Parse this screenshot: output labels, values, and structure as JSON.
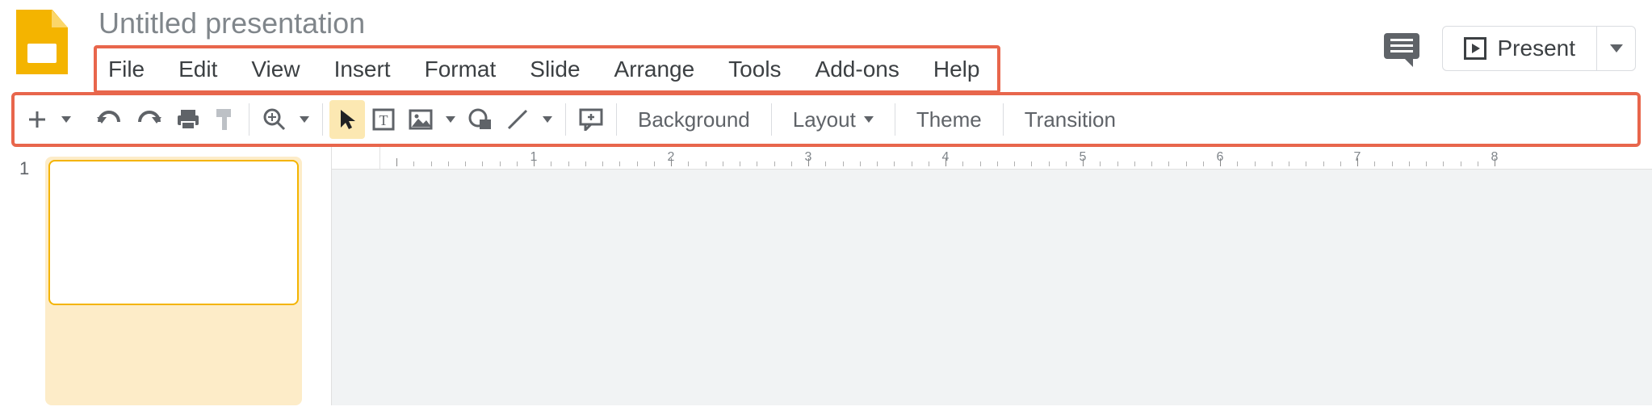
{
  "doc": {
    "title": "Untitled presentation"
  },
  "menus": {
    "file": "File",
    "edit": "Edit",
    "view": "View",
    "insert": "Insert",
    "format": "Format",
    "slide": "Slide",
    "arrange": "Arrange",
    "tools": "Tools",
    "addons": "Add-ons",
    "help": "Help"
  },
  "header": {
    "present_label": "Present"
  },
  "toolbar": {
    "background": "Background",
    "layout": "Layout",
    "theme": "Theme",
    "transition": "Transition"
  },
  "slides": {
    "current_index": "1"
  },
  "ruler": {
    "labels": [
      "1",
      "2",
      "3",
      "4",
      "5",
      "6",
      "7",
      "8"
    ]
  }
}
